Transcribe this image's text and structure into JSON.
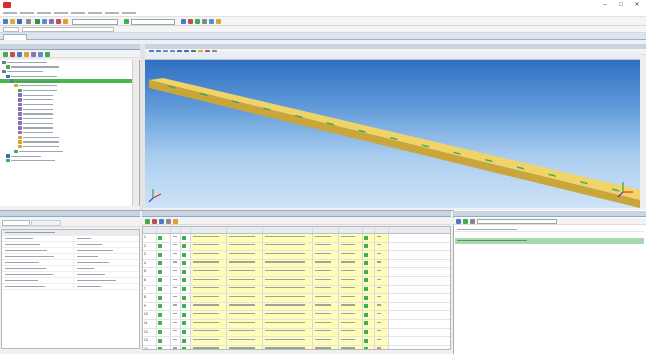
{
  "window": {
    "title": "",
    "controls": {
      "minimize": "–",
      "maximize": "□",
      "close": "✕"
    }
  },
  "document_tab": {
    "label": ""
  },
  "panels": {
    "tree_title": "",
    "viewport_title": "",
    "properties_title": "",
    "grid_title": "",
    "right_title": ""
  },
  "viewport": {
    "status_text": ""
  },
  "grid": {
    "headers": [
      "",
      "",
      "",
      "",
      "",
      "",
      "",
      "",
      "",
      ""
    ],
    "rows": [
      [
        "1",
        "",
        "",
        "",
        "",
        "",
        "",
        "",
        "",
        ""
      ],
      [
        "2",
        "",
        "",
        "",
        "",
        "",
        "",
        "",
        "",
        ""
      ],
      [
        "3",
        "",
        "",
        "",
        "",
        "",
        "",
        "",
        "",
        ""
      ],
      [
        "4",
        "",
        "",
        "",
        "",
        "",
        "",
        "",
        "",
        ""
      ],
      [
        "5",
        "",
        "",
        "",
        "",
        "",
        "",
        "",
        "",
        ""
      ],
      [
        "6",
        "",
        "",
        "",
        "",
        "",
        "",
        "",
        "",
        ""
      ],
      [
        "7",
        "",
        "",
        "",
        "",
        "",
        "",
        "",
        "",
        ""
      ],
      [
        "8",
        "",
        "",
        "",
        "",
        "",
        "",
        "",
        "",
        ""
      ],
      [
        "9",
        "",
        "",
        "",
        "",
        "",
        "",
        "",
        "",
        ""
      ],
      [
        "10",
        "",
        "",
        "",
        "",
        "",
        "",
        "",
        "",
        ""
      ],
      [
        "11",
        "",
        "",
        "",
        "",
        "",
        "",
        "",
        "",
        ""
      ],
      [
        "12",
        "",
        "",
        "",
        "",
        "",
        "",
        "",
        "",
        ""
      ],
      [
        "13",
        "",
        "",
        "",
        "",
        "",
        "",
        "",
        "",
        ""
      ],
      [
        "14",
        "",
        "",
        "",
        "",
        "",
        "",
        "",
        "",
        ""
      ],
      [
        "15",
        "",
        "",
        "",
        "",
        "",
        "",
        "",
        "",
        ""
      ]
    ]
  },
  "colors": {
    "accent_selection": "#48b84c",
    "beam_yellow": "#e8c84a",
    "beam_marker": "#2fa86a",
    "grid_yellow": "#fffdb8",
    "right_highlight": "#a8d8ae"
  }
}
